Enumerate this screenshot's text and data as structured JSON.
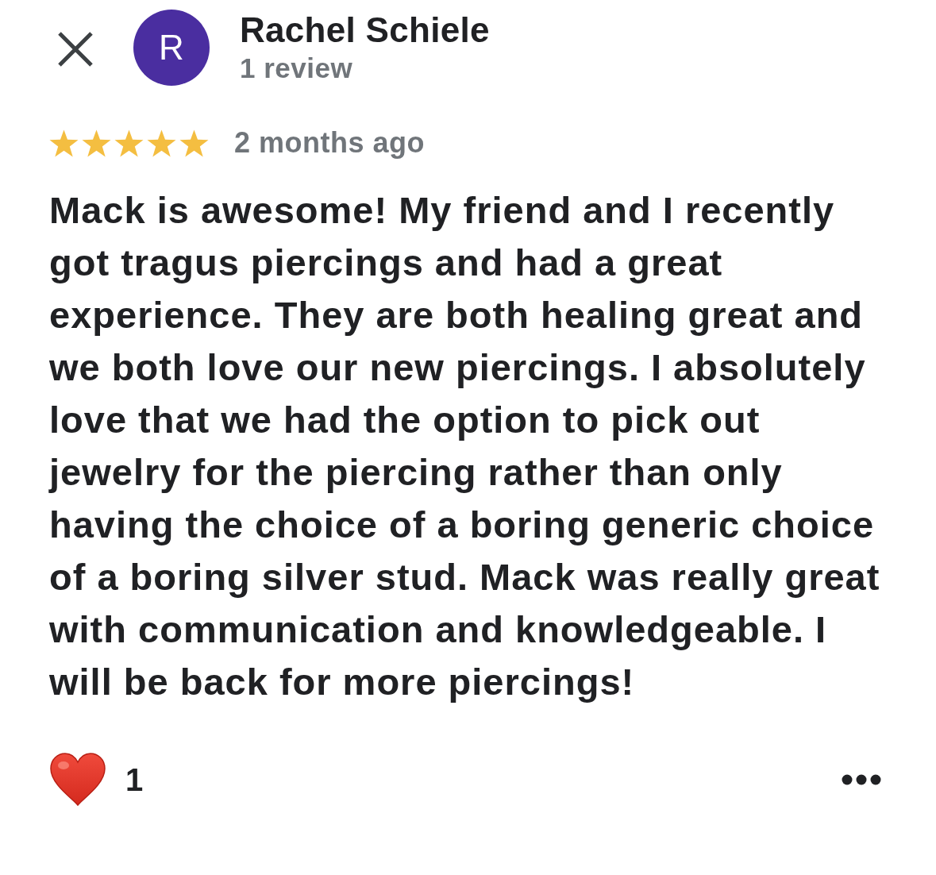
{
  "reviewer": {
    "initial": "R",
    "name": "Rachel Schiele",
    "review_count": "1 review"
  },
  "review": {
    "stars": 5,
    "time": "2 months ago",
    "text": "Mack is awesome! My friend and I recently got tragus piercings and had a great experience. They are both healing great and we both love our new piercings. I absolutely love that we had the option to pick out jewelry for the piercing rather than only having the choice of a boring generic choice of a boring silver stud. Mack was really great with communication and knowledgeable. I will be back for more piercings!"
  },
  "reactions": {
    "count": "1"
  }
}
